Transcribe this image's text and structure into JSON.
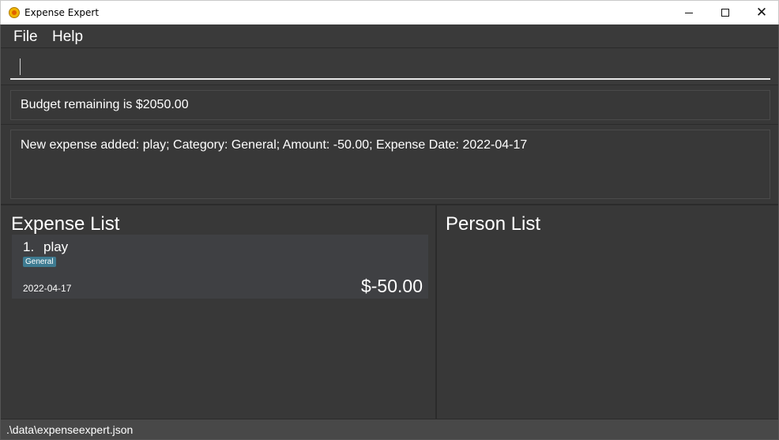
{
  "window": {
    "title": "Expense Expert",
    "icon": "app-coin-icon"
  },
  "menu": {
    "file": "File",
    "help": "Help"
  },
  "command": {
    "value": "",
    "placeholder": ""
  },
  "budget": {
    "text": "Budget remaining is $2050.00"
  },
  "result": {
    "text": "New expense added: play; Category: General; Amount: -50.00; Expense Date: 2022-04-17"
  },
  "expense_list": {
    "title": "Expense List",
    "items": [
      {
        "index": "1.",
        "name": "play",
        "category": "General",
        "date": "2022-04-17",
        "amount": "$-50.00"
      }
    ]
  },
  "person_list": {
    "title": "Person List",
    "items": []
  },
  "status": {
    "file_path": ".\\data\\expenseexpert.json"
  },
  "colors": {
    "background": "#383838",
    "card": "#3f4043",
    "tag": "#3e7b91",
    "text": "#ffffff"
  }
}
